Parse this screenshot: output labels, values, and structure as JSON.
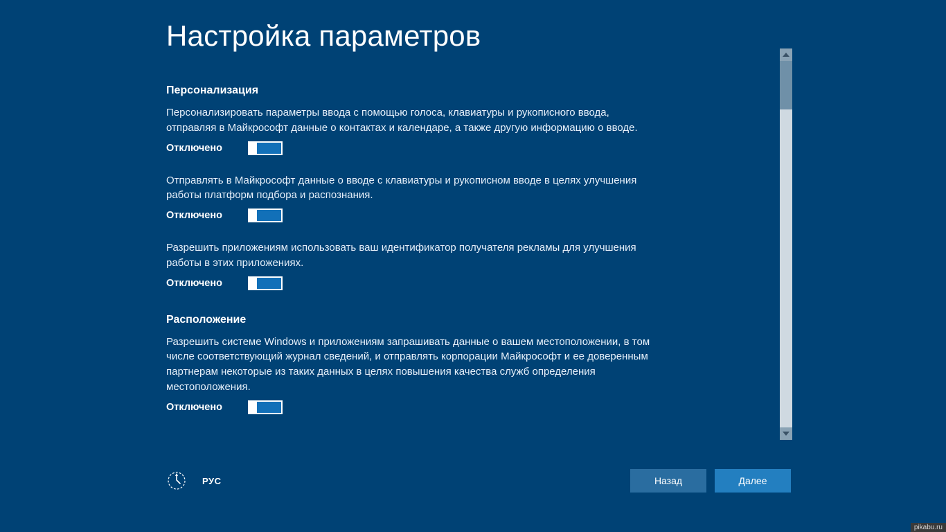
{
  "page": {
    "title": "Настройка параметров"
  },
  "sections": {
    "personalization": {
      "heading": "Персонализация",
      "items": [
        {
          "desc": "Персонализировать параметры ввода с помощью голоса, клавиатуры и рукописного ввода, отправляя в Майкрософт данные о контактах и календаре, а также другую информацию о вводе.",
          "state_label": "Отключено",
          "state": "off"
        },
        {
          "desc": "Отправлять в Майкрософт данные о вводе с клавиатуры и рукописном вводе в целях улучшения работы платформ подбора и распознания.",
          "state_label": "Отключено",
          "state": "off"
        },
        {
          "desc": "Разрешить приложениям использовать ваш идентификатор получателя рекламы для улучшения работы в этих приложениях.",
          "state_label": "Отключено",
          "state": "off"
        }
      ]
    },
    "location": {
      "heading": "Расположение",
      "items": [
        {
          "desc": "Разрешить системе Windows и приложениям запрашивать данные о вашем местоположении, в том числе соответствующий журнал сведений, и отправлять корпорации Майкрософт и ее доверенным партнерам некоторые из таких данных в целях повышения качества служб определения местоположения.",
          "state_label": "Отключено",
          "state": "off"
        }
      ]
    }
  },
  "footer": {
    "language": "РУС",
    "back": "Назад",
    "next": "Далее"
  },
  "watermark": "pikabu.ru"
}
